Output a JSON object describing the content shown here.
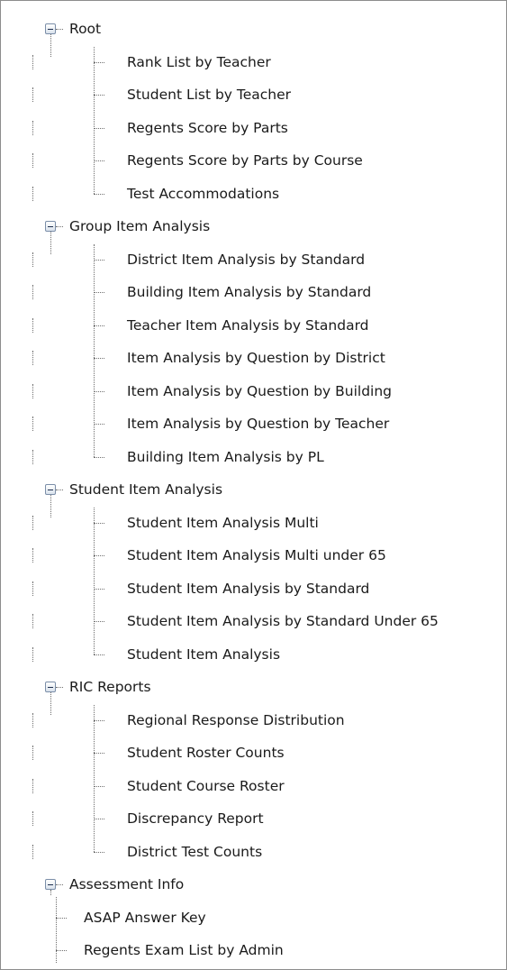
{
  "tree": {
    "groups": [
      {
        "label": "Root",
        "items": [
          "Rank List by Teacher",
          "Student List by Teacher",
          "Regents Score by Parts",
          "Regents Score by Parts by Course",
          "Test Accommodations"
        ]
      },
      {
        "label": "Group Item Analysis",
        "items": [
          "District Item Analysis by Standard",
          "Building Item Analysis by Standard",
          "Teacher Item Analysis by Standard",
          "Item Analysis by Question by District",
          "Item Analysis by Question by Building",
          "Item Analysis by Question by Teacher",
          "Building Item Analysis by PL"
        ]
      },
      {
        "label": "Student Item Analysis",
        "items": [
          "Student Item Analysis Multi",
          "Student Item Analysis Multi under 65",
          "Student Item Analysis by Standard",
          "Student Item Analysis by Standard Under 65",
          "Student Item Analysis"
        ]
      },
      {
        "label": "RIC Reports",
        "items": [
          "Regional Response Distribution",
          "Student Roster Counts",
          "Student Course Roster",
          "Discrepancy Report",
          "District Test Counts"
        ]
      },
      {
        "label": "Assessment Info",
        "items": [
          "ASAP Answer Key",
          "Regents Exam List by Admin"
        ]
      }
    ]
  }
}
